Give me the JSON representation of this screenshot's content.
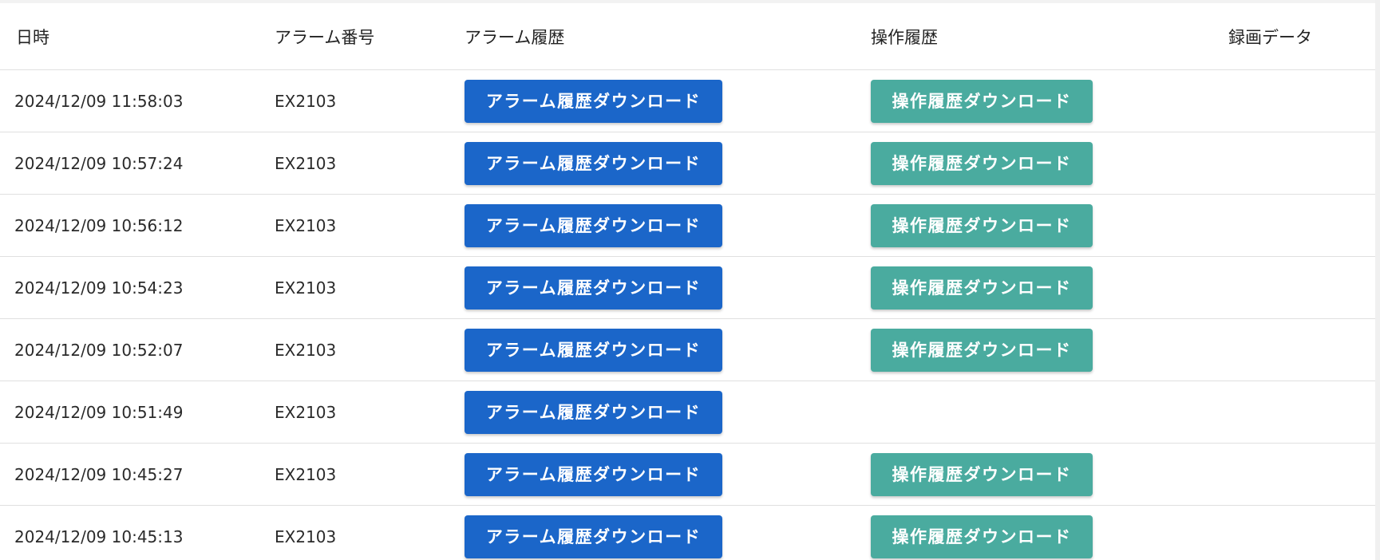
{
  "table": {
    "headers": {
      "datetime": "日時",
      "alarm_number": "アラーム番号",
      "alarm_history": "アラーム履歴",
      "operation_history": "操作履歴",
      "recording_data": "録画データ"
    },
    "alarm_button_label": "アラーム履歴ダウンロード",
    "operation_button_label": "操作履歴ダウンロード",
    "rows": [
      {
        "datetime": "2024/12/09 11:58:03",
        "alarm_number": "EX2103",
        "has_operation": true
      },
      {
        "datetime": "2024/12/09 10:57:24",
        "alarm_number": "EX2103",
        "has_operation": true
      },
      {
        "datetime": "2024/12/09 10:56:12",
        "alarm_number": "EX2103",
        "has_operation": true
      },
      {
        "datetime": "2024/12/09 10:54:23",
        "alarm_number": "EX2103",
        "has_operation": true
      },
      {
        "datetime": "2024/12/09 10:52:07",
        "alarm_number": "EX2103",
        "has_operation": true
      },
      {
        "datetime": "2024/12/09 10:51:49",
        "alarm_number": "EX2103",
        "has_operation": false
      },
      {
        "datetime": "2024/12/09 10:45:27",
        "alarm_number": "EX2103",
        "has_operation": true
      },
      {
        "datetime": "2024/12/09 10:45:13",
        "alarm_number": "EX2103",
        "has_operation": true
      }
    ]
  },
  "colors": {
    "alarm_button": "#1b66c9",
    "operation_button": "#4aab9f"
  }
}
